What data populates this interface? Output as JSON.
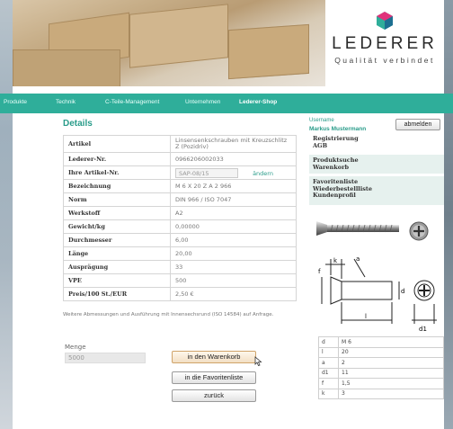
{
  "brand": {
    "name": "LEDERER",
    "tagline": "Qualität verbindet",
    "colors": {
      "accent": "#2fae9a",
      "heading": "#2a9c8a"
    }
  },
  "nav": {
    "items": [
      "Produkte",
      "Technik",
      "C-Teile-Management",
      "Unternehmen",
      "Lederer-Shop"
    ],
    "active": "Lederer-Shop"
  },
  "details": {
    "title": "Details",
    "rows": [
      {
        "label": "Artikel",
        "value": "Linsensenkschrauben mit Kreuzschlitz Z (Pozidriv)"
      },
      {
        "label": "Lederer-Nr.",
        "value": "0966206002033"
      },
      {
        "label": "Ihre Artikel-Nr.",
        "value": "SAP-08/15",
        "link": "ändern"
      },
      {
        "label": "Bezeichnung",
        "value": "M 6 X 20 Z A 2 966"
      },
      {
        "label": "Norm",
        "value": "DIN 966 / ISO 7047"
      },
      {
        "label": "Werkstoff",
        "value": "A2"
      },
      {
        "label": "Gewicht/kg",
        "value": "0,00000"
      },
      {
        "label": "Durchmesser",
        "value": "6,00"
      },
      {
        "label": "Länge",
        "value": "20,00"
      },
      {
        "label": "Ausprägung",
        "value": "33"
      },
      {
        "label": "VPE",
        "value": "500"
      },
      {
        "label": "Preis/100 St./EUR",
        "value": "2,50 €"
      }
    ],
    "note": "Weitere Abmessungen und Ausführung mit Innensechsrund (ISO 14584) auf Anfrage."
  },
  "order": {
    "qty_label": "Menge",
    "qty_value": "5000",
    "cart_button": "in den Warenkorb",
    "fav_button": "in die Favoritenliste",
    "back_button": "zurück"
  },
  "sidebar": {
    "user_label": "Username",
    "user_name": "Markus Mustermann",
    "logout": "abmelden",
    "block1": [
      "Registrierung",
      "AGB"
    ],
    "block2": [
      "Produktsuche",
      "Warenkorb"
    ],
    "block3": [
      "Favoritenliste",
      "Wiederbestellliste",
      "Kundenprofil"
    ]
  },
  "drawing": {
    "labels": [
      "k",
      "a",
      "f",
      "d",
      "l",
      "d1"
    ]
  },
  "dims": [
    {
      "k": "d",
      "v": "M 6"
    },
    {
      "k": "l",
      "v": "20"
    },
    {
      "k": "a",
      "v": "2"
    },
    {
      "k": "d1",
      "v": "11"
    },
    {
      "k": "f",
      "v": "1,5"
    },
    {
      "k": "k",
      "v": "3"
    }
  ]
}
